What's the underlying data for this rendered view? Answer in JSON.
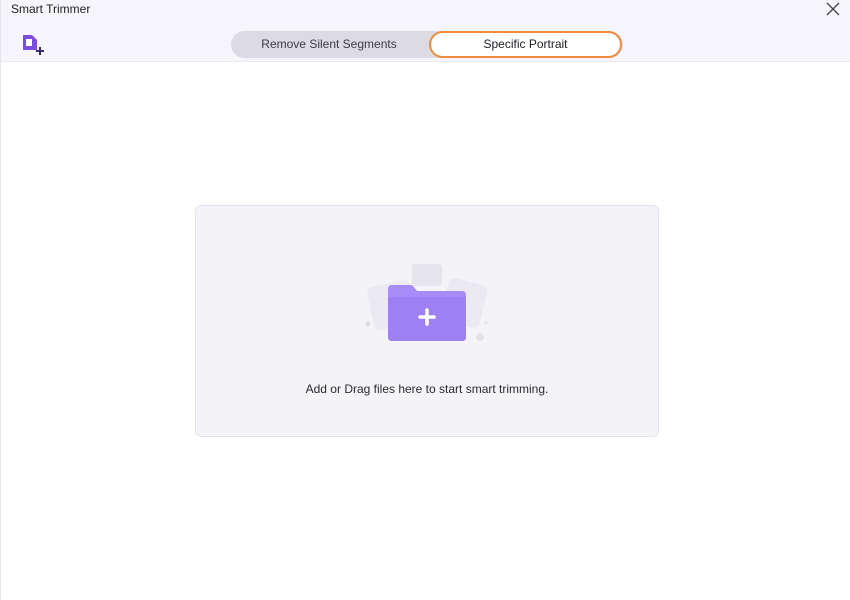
{
  "window": {
    "title": "Smart Trimmer"
  },
  "toolbar": {
    "add_file_icon": "file-add-icon",
    "close_icon": "close-icon"
  },
  "tabs": [
    {
      "label": "Remove Silent Segments",
      "active": false
    },
    {
      "label": "Specific Portrait",
      "active": true
    }
  ],
  "dropzone": {
    "icon": "folder-add-icon",
    "text": "Add or Drag files here to start smart trimming."
  },
  "colors": {
    "accent": "#8b5cf6",
    "active_tab_border": "#f08a3c",
    "folder": "#a98bf7"
  }
}
